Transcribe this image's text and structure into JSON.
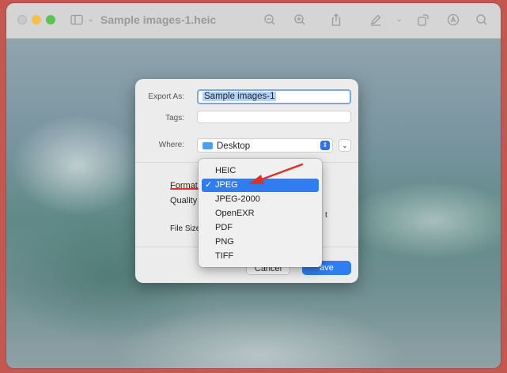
{
  "window": {
    "title": "Sample images-1.heic"
  },
  "dialog": {
    "export_as_label": "Export As:",
    "export_as_value": "Sample images-1",
    "tags_label": "Tags:",
    "tags_value": "",
    "where_label": "Where:",
    "where_value": "Desktop",
    "format_label": "Format",
    "quality_label": "Quality",
    "file_size_label": "File Size",
    "trailing_char": "t",
    "cancel_label": "Cancel",
    "save_label": "ave"
  },
  "format_menu": {
    "selected": "JPEG",
    "options": [
      "HEIC",
      "JPEG",
      "JPEG-2000",
      "OpenEXR",
      "PDF",
      "PNG",
      "TIFF"
    ],
    "check_glyph": "✓"
  },
  "colors": {
    "accent": "#2f7df0",
    "annotation": "#e0302d",
    "traffic_yellow": "#f5bf4f",
    "traffic_green": "#5ec451"
  },
  "icons": [
    "sidebar-icon",
    "zoom-out-icon",
    "zoom-in-icon",
    "share-icon",
    "markup-icon",
    "rotate-icon",
    "account-icon",
    "search-icon",
    "folder-icon",
    "arrow-annotation"
  ]
}
